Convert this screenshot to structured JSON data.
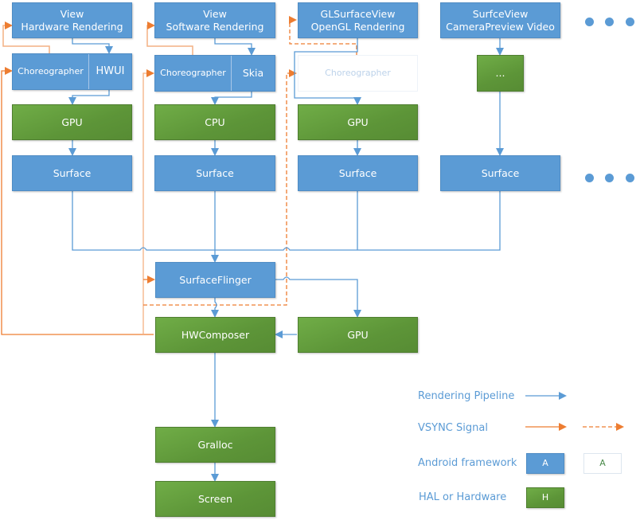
{
  "diagram": {
    "top_sources": [
      {
        "id": "view-hw",
        "line1": "View",
        "line2": "Hardware Rendering"
      },
      {
        "id": "view-sw",
        "line1": "View",
        "line2": "Software Rendering"
      },
      {
        "id": "glsurfaceview",
        "line1": "GLSurfaceView",
        "line2": "OpenGL Rendering"
      },
      {
        "id": "surfaceview",
        "line1": "SurfceView",
        "line2": "CameraPreview Video"
      }
    ],
    "second_row": {
      "col1": {
        "left": "Choreographer",
        "right": "HWUI"
      },
      "col2": {
        "left": "Choreographer",
        "right": "Skia"
      },
      "col3": {
        "label": "Choreographer"
      },
      "col4": {
        "label": "..."
      }
    },
    "processors": [
      "GPU",
      "CPU",
      "GPU"
    ],
    "surfaces": [
      "Surface",
      "Surface",
      "Surface",
      "Surface"
    ],
    "surfaceflinger": "SurfaceFlinger",
    "hwcomposer": "HWComposer",
    "composer_gpu": "GPU",
    "gralloc": "Gralloc",
    "screen": "Screen",
    "more_indicator": "more-sources"
  },
  "legend": {
    "rendering_pipeline": "Rendering Pipeline",
    "vsync_signal": "VSYNC Signal",
    "android_framework": "Android framework",
    "android_framework_sample": "A",
    "android_framework_sample_alt": "A",
    "hal_or_hardware": "HAL or Hardware",
    "hal_sample": "H"
  },
  "colors": {
    "framework_blue": "#5b9bd5",
    "hardware_green": "#70ad47",
    "pipeline_line": "#5b9bd5",
    "vsync_line": "#ed7d31"
  }
}
